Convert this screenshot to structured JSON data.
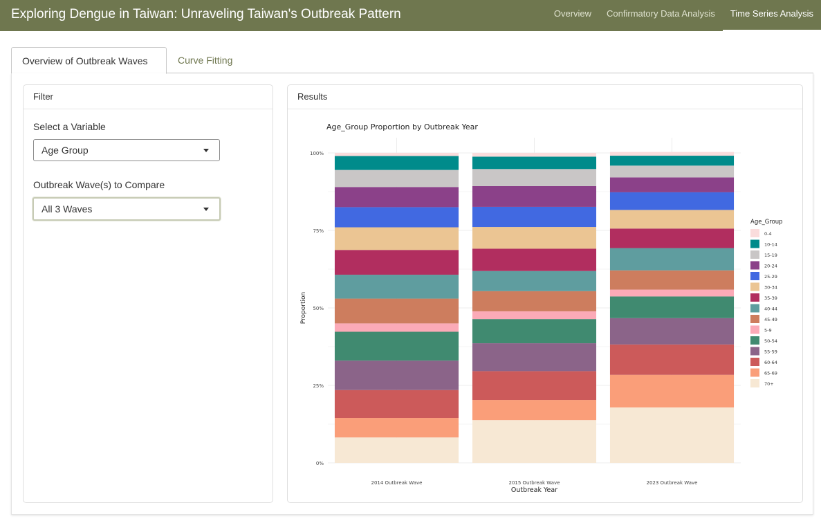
{
  "app": {
    "title": "Exploring Dengue in Taiwan: Unraveling Taiwan's Outbreak Pattern",
    "nav": [
      "Overview",
      "Confirmatory Data Analysis",
      "Time Series Analysis"
    ],
    "active_nav": "Time Series Analysis"
  },
  "tabs": [
    "Overview of Outbreak Waves",
    "Curve Fitting"
  ],
  "active_tab": "Overview of Outbreak Waves",
  "filter": {
    "header": "Filter",
    "variable_label": "Select a Variable",
    "variable_value": "Age Group",
    "waves_label": "Outbreak Wave(s) to Compare",
    "waves_value": "All 3 Waves"
  },
  "results": {
    "header": "Results"
  },
  "chart_data": {
    "type": "bar",
    "stacked": true,
    "title": "Age_Group Proportion by Outbreak Year",
    "xlabel": "Outbreak Year",
    "ylabel": "Proportion",
    "ylim": [
      0,
      1
    ],
    "yticks": [
      "0%",
      "25%",
      "50%",
      "75%",
      "100%"
    ],
    "categories": [
      "2014 Outbreak Wave",
      "2015 Outbreak Wave",
      "2023 Outbreak Wave"
    ],
    "legend_title": "Age_Group",
    "legend_position": "right",
    "series": [
      {
        "name": "70+",
        "color": "#f7e8d4",
        "values": [
          0.082,
          0.138,
          0.179
        ]
      },
      {
        "name": "65-69",
        "color": "#fa9e79",
        "values": [
          0.063,
          0.065,
          0.105
        ]
      },
      {
        "name": "60-64",
        "color": "#cc5a5a",
        "values": [
          0.09,
          0.093,
          0.098
        ]
      },
      {
        "name": "55-59",
        "color": "#8b6489",
        "values": [
          0.095,
          0.09,
          0.085
        ]
      },
      {
        "name": "50-54",
        "color": "#408a70",
        "values": [
          0.093,
          0.078,
          0.07
        ]
      },
      {
        "name": "5-9",
        "color": "#fbaab7",
        "values": [
          0.027,
          0.025,
          0.022
        ]
      },
      {
        "name": "45-49",
        "color": "#cd7d5e",
        "values": [
          0.08,
          0.065,
          0.062
        ]
      },
      {
        "name": "40-44",
        "color": "#5f9d9f",
        "values": [
          0.077,
          0.065,
          0.072
        ]
      },
      {
        "name": "35-39",
        "color": "#b12e5f",
        "values": [
          0.08,
          0.072,
          0.063
        ]
      },
      {
        "name": "30-34",
        "color": "#ebc593",
        "values": [
          0.073,
          0.07,
          0.06
        ]
      },
      {
        "name": "25-29",
        "color": "#4169e1",
        "values": [
          0.065,
          0.065,
          0.057
        ]
      },
      {
        "name": "20-24",
        "color": "#8b4189",
        "values": [
          0.065,
          0.067,
          0.048
        ]
      },
      {
        "name": "15-19",
        "color": "#c9c6c6",
        "values": [
          0.055,
          0.055,
          0.038
        ]
      },
      {
        "name": "10-14",
        "color": "#008b8b",
        "values": [
          0.045,
          0.04,
          0.032
        ]
      },
      {
        "name": "0-4",
        "color": "#fadcdc",
        "values": [
          0.01,
          0.012,
          0.012
        ]
      }
    ],
    "legend_order": [
      "0-4",
      "10-14",
      "15-19",
      "20-24",
      "25-29",
      "30-34",
      "35-39",
      "40-44",
      "45-49",
      "5-9",
      "50-54",
      "55-59",
      "60-64",
      "65-69",
      "70+"
    ]
  }
}
